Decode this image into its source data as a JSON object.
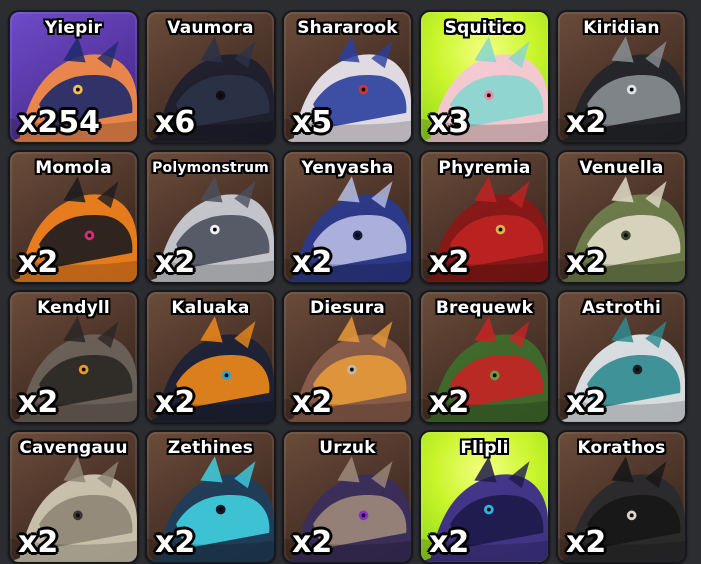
{
  "cards": [
    {
      "name": "Yiepir",
      "count": "x254",
      "bg": "purple",
      "colors": [
        "#f08a48",
        "#1d2a6b",
        "#f2c04a"
      ]
    },
    {
      "name": "Vaumora",
      "count": "x6",
      "bg": "brown",
      "colors": [
        "#1d1f2e",
        "#2c3348",
        "#0f1018"
      ]
    },
    {
      "name": "Shararook",
      "count": "x5",
      "bg": "brown",
      "colors": [
        "#e8e4ec",
        "#2a3f9e",
        "#c43a3a"
      ]
    },
    {
      "name": "Squitico",
      "count": "x3",
      "bg": "lime",
      "colors": [
        "#f4c6d8",
        "#86d6cf",
        "#f08aa8"
      ]
    },
    {
      "name": "Kiridian",
      "count": "x2",
      "bg": "brown",
      "colors": [
        "#23252a",
        "#8a8f94",
        "#dfe3e6"
      ]
    },
    {
      "name": "Momola",
      "count": "x2",
      "bg": "brown",
      "colors": [
        "#ef7f1e",
        "#1b1b1f",
        "#d92c7a"
      ]
    },
    {
      "name": "Polymonstrum",
      "count": "x2",
      "bg": "brown",
      "colors": [
        "#c9ccd3",
        "#4b4f5c",
        "#eef0f4"
      ]
    },
    {
      "name": "Yenyasha",
      "count": "x2",
      "bg": "brown",
      "colors": [
        "#2b3a8c",
        "#b8bde6",
        "#161a3c"
      ]
    },
    {
      "name": "Phyremia",
      "count": "x2",
      "bg": "brown",
      "colors": [
        "#8a1717",
        "#c02323",
        "#e0b04a"
      ]
    },
    {
      "name": "Venuella",
      "count": "x2",
      "bg": "brown",
      "colors": [
        "#6e7e4b",
        "#e2dcc8",
        "#3e4a2c"
      ]
    },
    {
      "name": "Kendyll",
      "count": "x2",
      "bg": "brown",
      "colors": [
        "#6b625a",
        "#2a2724",
        "#e39b2c"
      ]
    },
    {
      "name": "Kaluaka",
      "count": "x2",
      "bg": "brown",
      "colors": [
        "#1c2236",
        "#ef8a1a",
        "#2fa3d6"
      ]
    },
    {
      "name": "Diesura",
      "count": "x2",
      "bg": "brown",
      "colors": [
        "#8a5e4b",
        "#e79a3a",
        "#c7b7ab"
      ]
    },
    {
      "name": "Brequewk",
      "count": "x2",
      "bg": "brown",
      "colors": [
        "#3f6b2c",
        "#c82323",
        "#6f9a46"
      ]
    },
    {
      "name": "Astrothi",
      "count": "x2",
      "bg": "brown",
      "colors": [
        "#dfe6ea",
        "#2f8a8f",
        "#1c2228"
      ]
    },
    {
      "name": "Cavengauu",
      "count": "x2",
      "bg": "brown",
      "colors": [
        "#cfc7b1",
        "#8e8574",
        "#3a352e"
      ]
    },
    {
      "name": "Zethines",
      "count": "x2",
      "bg": "brown",
      "colors": [
        "#1f3d5a",
        "#3fd0e0",
        "#0f1a26"
      ]
    },
    {
      "name": "Urzuk",
      "count": "x2",
      "bg": "brown",
      "colors": [
        "#3a2e5c",
        "#9e8a7a",
        "#8a2bd0"
      ]
    },
    {
      "name": "Flipli",
      "count": "x2",
      "bg": "lime",
      "colors": [
        "#3a2a8a",
        "#1e1a4a",
        "#2fb2e0"
      ]
    },
    {
      "name": "Korathos",
      "count": "x2",
      "bg": "brown",
      "colors": [
        "#2a2a2c",
        "#161617",
        "#d9d4c4"
      ]
    }
  ]
}
